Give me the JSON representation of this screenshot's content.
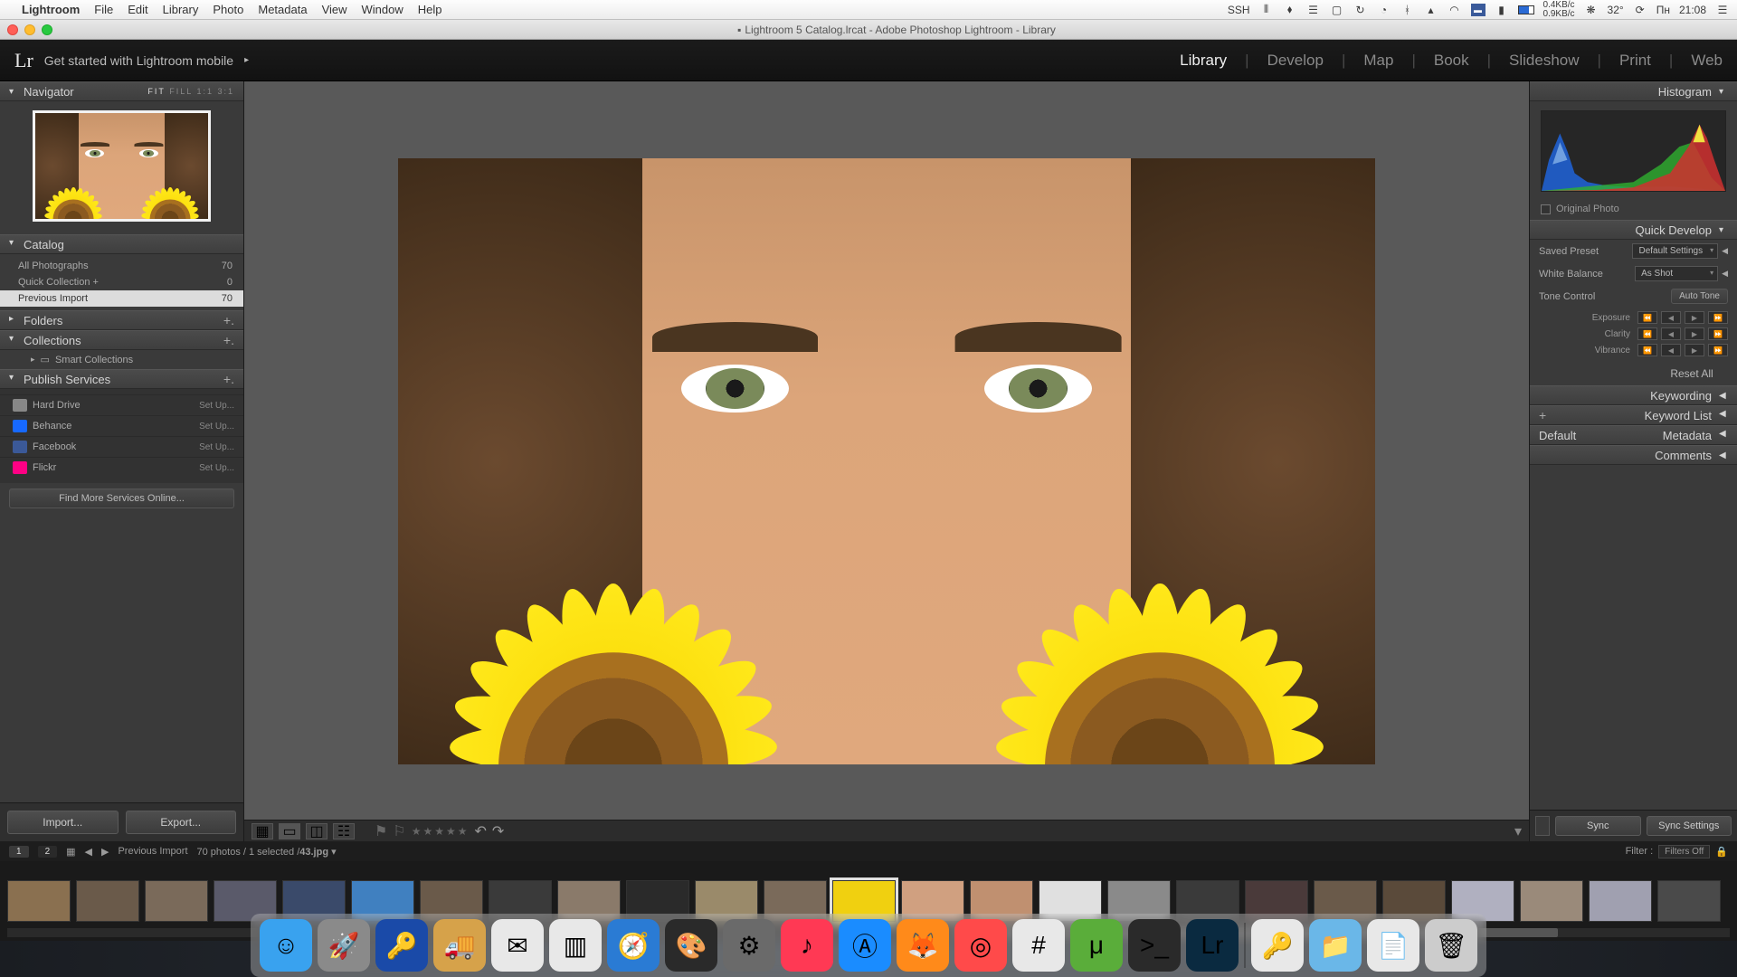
{
  "mac_menu": {
    "app": "Lightroom",
    "items": [
      "File",
      "Edit",
      "Library",
      "Photo",
      "Metadata",
      "View",
      "Window",
      "Help"
    ],
    "right": {
      "ssh": "SSH",
      "net_up": "0.4KB/c",
      "net_dn": "0.9KB/c",
      "temp": "32°",
      "day": "Пн",
      "time": "21:08"
    }
  },
  "window": {
    "title": "Lightroom 5 Catalog.lrcat - Adobe Photoshop Lightroom - Library"
  },
  "lr_header": {
    "mobile": "Get started with Lightroom mobile",
    "modules": [
      "Library",
      "Develop",
      "Map",
      "Book",
      "Slideshow",
      "Print",
      "Web"
    ],
    "active": "Library"
  },
  "left": {
    "navigator": {
      "title": "Navigator",
      "zoom": [
        "FIT",
        "FILL",
        "1:1",
        "3:1"
      ],
      "zoom_active": "FIT"
    },
    "catalog": {
      "title": "Catalog",
      "items": [
        {
          "label": "All Photographs",
          "count": "70"
        },
        {
          "label": "Quick Collection  +",
          "count": "0"
        },
        {
          "label": "Previous Import",
          "count": "70"
        }
      ],
      "selected": 2
    },
    "folders": {
      "title": "Folders"
    },
    "collections": {
      "title": "Collections",
      "smart": "Smart Collections"
    },
    "publish": {
      "title": "Publish Services",
      "items": [
        {
          "label": "Hard Drive",
          "setup": "Set Up...",
          "color": "#888888"
        },
        {
          "label": "Behance",
          "setup": "Set Up...",
          "color": "#1769ff"
        },
        {
          "label": "Facebook",
          "setup": "Set Up...",
          "color": "#3b5998"
        },
        {
          "label": "Flickr",
          "setup": "Set Up...",
          "color": "#ff0084"
        }
      ],
      "find_more": "Find More Services Online..."
    },
    "footer": {
      "import": "Import...",
      "export": "Export..."
    }
  },
  "right": {
    "histogram": {
      "title": "Histogram",
      "orig": "Original Photo"
    },
    "quick_develop": {
      "title": "Quick Develop",
      "saved_preset": {
        "label": "Saved Preset",
        "value": "Default Settings"
      },
      "white_balance": {
        "label": "White Balance",
        "value": "As Shot"
      },
      "tone_control": {
        "label": "Tone Control",
        "btn": "Auto Tone"
      },
      "sliders": [
        "Exposure",
        "Clarity",
        "Vibrance"
      ],
      "reset": "Reset All"
    },
    "sections": [
      "Keywording",
      "Keyword List",
      "Metadata",
      "Comments"
    ],
    "metadata_dd": "Default",
    "footer": {
      "sync": "Sync",
      "sync_settings": "Sync Settings"
    }
  },
  "filter_bar": {
    "badges": [
      "1",
      "2"
    ],
    "breadcrumb": "Previous Import",
    "count": "70 photos / 1 selected /",
    "file": "43.jpg",
    "filter": "Filter :",
    "filters_off": "Filters Off"
  },
  "filmstrip": {
    "count": 25,
    "selected": 12
  },
  "dock": {
    "items": [
      {
        "name": "finder",
        "bg": "#39a2ef",
        "glyph": "☺"
      },
      {
        "name": "launchpad",
        "bg": "#8a8a8a",
        "glyph": "🚀"
      },
      {
        "name": "1password-a",
        "bg": "#1a4aa8",
        "glyph": "🔑"
      },
      {
        "name": "transmit",
        "bg": "#d6a24a",
        "glyph": "🚚"
      },
      {
        "name": "mail",
        "bg": "#e8e8e8",
        "glyph": "✉"
      },
      {
        "name": "parallels",
        "bg": "#e8e8e8",
        "glyph": "▥"
      },
      {
        "name": "safari",
        "bg": "#2a7bd4",
        "glyph": "🧭"
      },
      {
        "name": "pixelmator",
        "bg": "#2a2a2a",
        "glyph": "🎨"
      },
      {
        "name": "settings",
        "bg": "#6a6a6a",
        "glyph": "⚙"
      },
      {
        "name": "itunes",
        "bg": "#ff3954",
        "glyph": "♪"
      },
      {
        "name": "appstore",
        "bg": "#1a8cff",
        "glyph": "Ⓐ"
      },
      {
        "name": "firefox",
        "bg": "#ff8a1a",
        "glyph": "🦊"
      },
      {
        "name": "chrome-canary",
        "bg": "#ff4a4a",
        "glyph": "◎"
      },
      {
        "name": "slack",
        "bg": "#e8e8e8",
        "glyph": "#"
      },
      {
        "name": "utorrent",
        "bg": "#5aad3a",
        "glyph": "μ"
      },
      {
        "name": "iterm",
        "bg": "#2a2a2a",
        "glyph": ">_"
      },
      {
        "name": "lightroom",
        "bg": "#0a2a40",
        "glyph": "Lr"
      }
    ],
    "right": [
      {
        "name": "1password-b",
        "bg": "#e8e8e8",
        "glyph": "🔑"
      },
      {
        "name": "downloads",
        "bg": "#6ab7e8",
        "glyph": "📁"
      },
      {
        "name": "documents",
        "bg": "#e8e8e8",
        "glyph": "📄"
      },
      {
        "name": "trash",
        "bg": "#cccccc",
        "glyph": "🗑"
      }
    ]
  }
}
